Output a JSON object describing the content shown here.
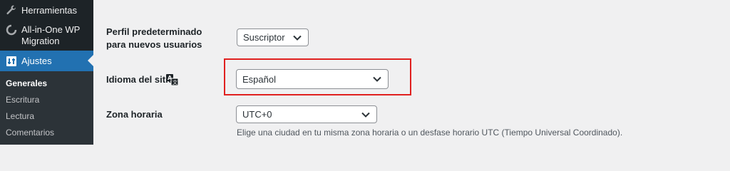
{
  "sidebar": {
    "items": [
      {
        "label": "Herramientas",
        "icon": "wrench-icon"
      },
      {
        "label": "All-in-One WP Migration",
        "icon": "migration-icon"
      },
      {
        "label": "Ajustes",
        "icon": "settings-icon",
        "active": true
      }
    ],
    "submenu": [
      "Generales",
      "Escritura",
      "Lectura",
      "Comentarios"
    ],
    "current_submenu": "Generales",
    "active_color": "#2271b1"
  },
  "form": {
    "default_role": {
      "label": "Perfil predeterminado para nuevos usuarios",
      "value": "Suscriptor"
    },
    "site_language": {
      "label": "Idioma del sitio",
      "value": "Español",
      "icon": "translation-icon"
    },
    "timezone": {
      "label": "Zona horaria",
      "value": "UTC+0",
      "description": "Elige una ciudad en tu misma zona horaria o un desfase horario UTC (Tiempo Universal Coordinado)."
    }
  },
  "highlight_color": "#e0201f"
}
